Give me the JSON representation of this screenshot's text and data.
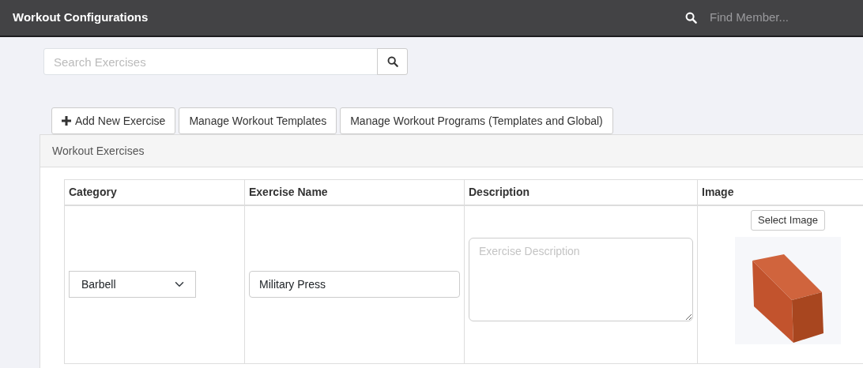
{
  "navbar": {
    "title": "Workout Configurations",
    "search": {
      "placeholder": "Find Member..."
    }
  },
  "exercise_search": {
    "placeholder": "Search Exercises"
  },
  "actions": [
    {
      "label": "Add New Exercise",
      "kind": "add"
    },
    {
      "label": "Manage Workout Templates",
      "kind": "plain"
    },
    {
      "label": "Manage Workout Programs (Templates and Global)",
      "kind": "plain"
    }
  ],
  "panel": {
    "title": "Workout Exercises",
    "table": {
      "columns": [
        "Category",
        "Exercise Name",
        "Description",
        "Image"
      ],
      "rows": [
        {
          "category": "Barbell",
          "exercise_name": "Military Press",
          "description": {
            "placeholder": "Exercise Description"
          },
          "image_button": "Select Image"
        }
      ]
    }
  }
}
